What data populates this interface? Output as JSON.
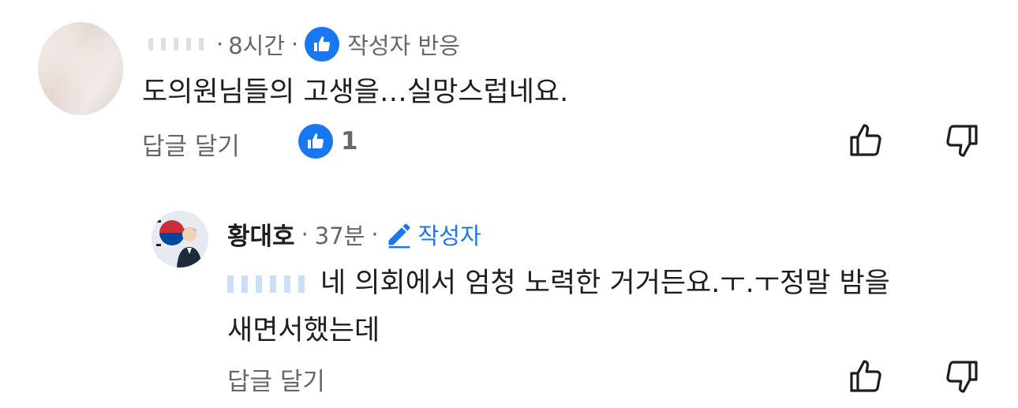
{
  "comment": {
    "time": "8시간",
    "separator": "·",
    "reaction_label": "작성자 반응",
    "text": "도의원님들의 고생을…실망스럽네요.",
    "reply_label": "답글 달기",
    "like_count": "1"
  },
  "reply": {
    "author": "황대호",
    "time": "37분",
    "separator": "·",
    "author_badge": "작성자",
    "text_line1": "네 의회에서 엄청 노력한 거거든요.ㅜ.ㅜ정말 밤을",
    "text_line2": "새면서했는데",
    "reply_label": "답글 달기"
  },
  "colors": {
    "accent": "#1877f2",
    "muted_text": "#65676b",
    "body_text": "#1c1e21"
  },
  "icons": {
    "like_badge": "thumbs-up-icon",
    "like": "thumbs-up-outline-icon",
    "dislike": "thumbs-down-outline-icon",
    "author_badge": "pencil-icon"
  }
}
